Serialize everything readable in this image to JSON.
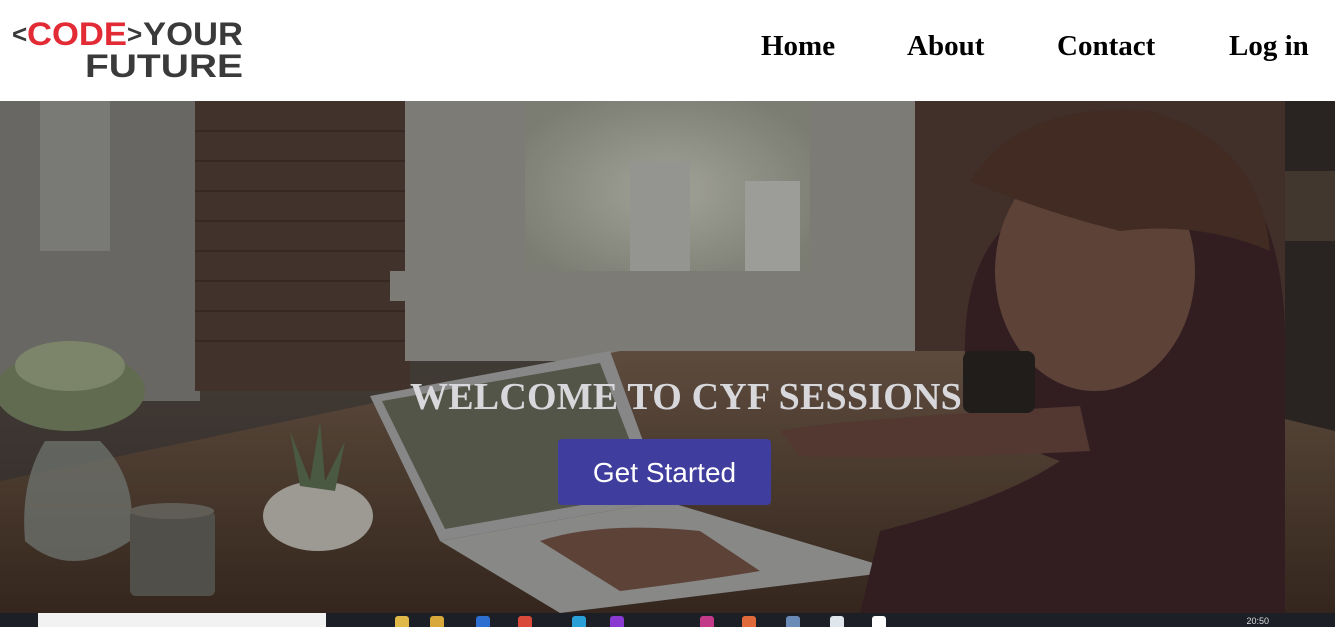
{
  "logo": {
    "code": "CODE",
    "your": "YOUR",
    "future": "FUTURE",
    "lt": "<",
    "gt": ">"
  },
  "nav": {
    "items": [
      "Home",
      "About",
      "Contact",
      "Log in"
    ]
  },
  "hero": {
    "title": "WELCOME TO CYF SESSIONS",
    "cta_label": "Get Started"
  },
  "taskbar": {
    "clock": "20:50"
  },
  "colors": {
    "brand_red": "#e22b35",
    "brand_dark": "#3a3a3a",
    "cta": "#3f3d9d"
  }
}
